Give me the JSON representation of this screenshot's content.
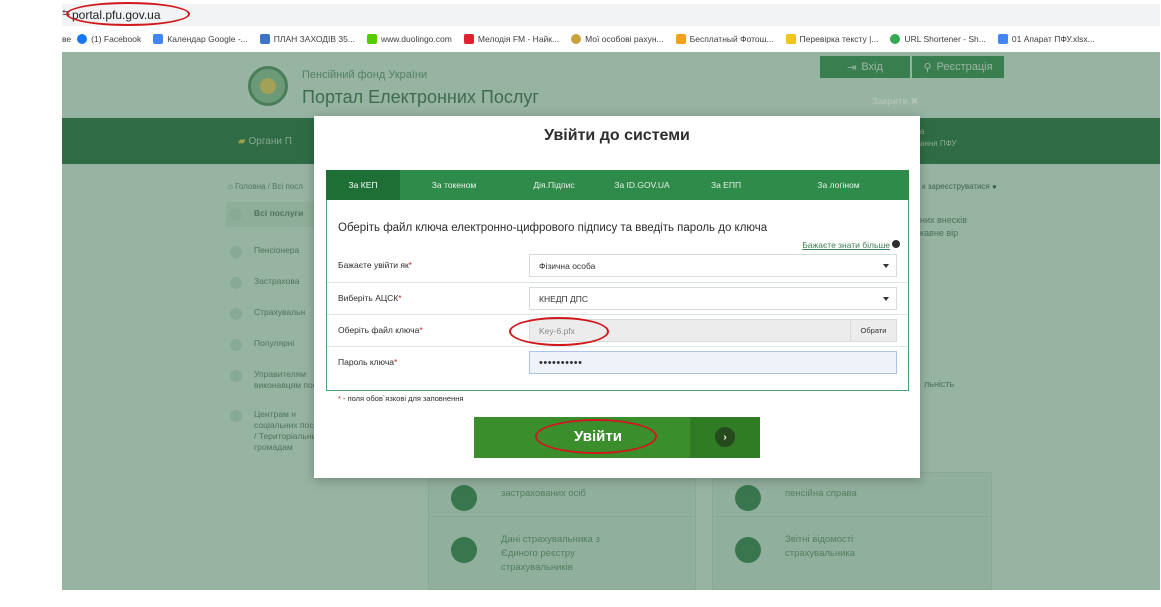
{
  "browser": {
    "url": "portal.pfu.gov.ua",
    "bookmarks": [
      {
        "label": "(1) Facebook",
        "color": "#1877f2"
      },
      {
        "label": "Календар Google -...",
        "color": "#4285f4"
      },
      {
        "label": "ПЛАН ЗАХОДІВ 35...",
        "color": "#3b73c7"
      },
      {
        "label": "www.duolingo.com",
        "color": "#58cc02"
      },
      {
        "label": "Мелодія FM - Найк...",
        "color": "#e0212d"
      },
      {
        "label": "Мої особові рахун...",
        "color": "#c8a23b"
      },
      {
        "label": "Бесплатный Фотош...",
        "color": "#f2a01f"
      },
      {
        "label": "Перевірка тексту |...",
        "color": "#f0c419"
      },
      {
        "label": "URL Shortener - Sh...",
        "color": "#35a853"
      },
      {
        "label": "01 Апарат ПФУ.xlsx...",
        "color": "#4285f4"
      }
    ]
  },
  "site": {
    "brand_sub": "Пенсійний фонд України",
    "brand_main": "Портал Електронних Послуг",
    "login": "Вхід",
    "register": "Реєстрація",
    "close": "Закрити",
    "nav_left": "Органи П",
    "nav_right_1": "а",
    "nav_right_2": "ання ПФУ",
    "breadcrumb": "Головна / Всі посл",
    "register_link": "к зареєструватися",
    "sidebar": [
      {
        "label": "Всі послуги"
      },
      {
        "label": "Пенсіонера"
      },
      {
        "label": "Застрахова"
      },
      {
        "label": "Страхувальн"
      },
      {
        "label": "Популярні"
      },
      {
        "label": "Управителям виконавцям послуг"
      },
      {
        "label": "Центрам н соціальних послуг / Територіальним громадам"
      }
    ],
    "cards": {
      "c1": "застрахованих осіб",
      "c2": "пенсійна справа",
      "c3": "Дані страхувальника з Єдиного реєстру страхувальників",
      "c4": "Звітні відомості страхувальника",
      "side1": "них внесків кавне вір",
      "side2": "льність"
    }
  },
  "modal": {
    "title": "Увійти до системи",
    "tabs": [
      {
        "label": "За КЕП",
        "active": true
      },
      {
        "label": "За токеном",
        "active": false
      },
      {
        "label": "Дія.Підпис",
        "active": false
      },
      {
        "label": "За ID.GOV.UA",
        "active": false
      },
      {
        "label": "За ЕПП",
        "active": false
      },
      {
        "label": "За логіном",
        "active": false
      }
    ],
    "heading": "Оберіть файл ключа електронно-цифрового підпису та введіть пароль до ключа",
    "more_link": "Бажаєте знати більше",
    "fields": {
      "login_as_label": "Бажаєте увійти як",
      "login_as_value": "Фізична особа",
      "acsk_label": "Виберіть АЦСК",
      "acsk_value": "КНЕДП ДПС",
      "keyfile_label": "Оберіть файл ключа",
      "keyfile_value": "Key-6.pfx",
      "pick_button": "Обрати",
      "password_label": "Пароль ключа",
      "password_value": "••••••••••"
    },
    "required_marker": "*",
    "required_note": " - поля обов`язкові для заповнення",
    "submit": "Увійти"
  },
  "colors": {
    "brand_green": "#2e8b4a",
    "active_tab": "#1e6f36",
    "submit_green": "#3a8f2c",
    "annotation_red": "#d0181c"
  }
}
